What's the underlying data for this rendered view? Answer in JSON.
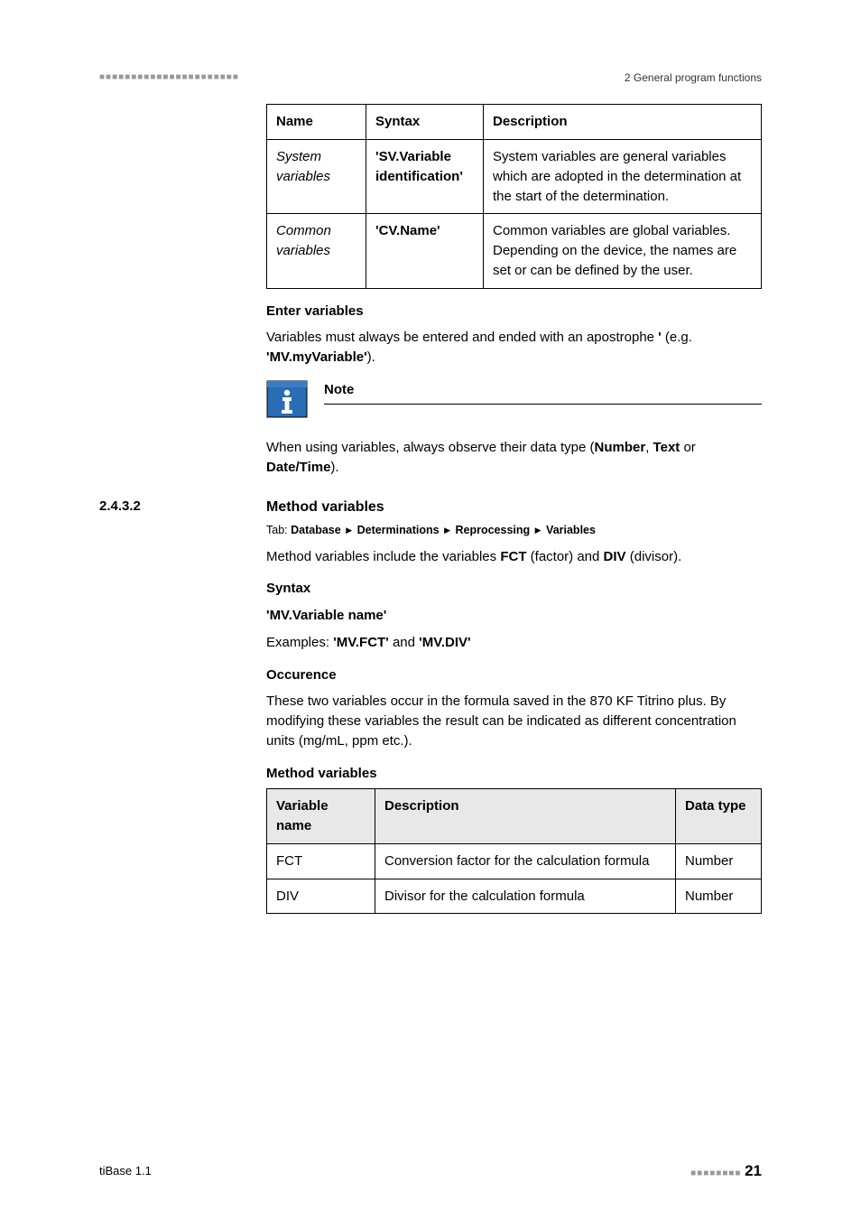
{
  "header": {
    "dots_long": "■■■■■■■■■■■■■■■■■■■■■■",
    "right": "2 General program functions"
  },
  "table1": {
    "headers": {
      "name": "Name",
      "syntax": "Syntax",
      "description": "Description"
    },
    "rows": [
      {
        "name": "System variables",
        "syntax": "'SV.Variable identification'",
        "description": "System variables are general variables which are adopted in the determination at the start of the determination."
      },
      {
        "name": "Common variables",
        "syntax": "'CV.Name'",
        "description": "Common variables are global variables. Depending on the device, the names are set or can be defined by the user."
      }
    ]
  },
  "enter_vars": {
    "heading": "Enter variables",
    "text_before": "Variables must always be entered and ended with an apostrophe ",
    "apos": "'",
    "eg": " (e.g. ",
    "example": "'MV.myVariable'",
    "close": ")."
  },
  "note": {
    "title": "Note",
    "body_before": "When using variables, always observe their data type (",
    "t1": "Number",
    "sep1": ", ",
    "t2": "Text",
    "sep2": " or ",
    "t3": "Date/Time",
    "close": ")."
  },
  "section": {
    "num": "2.4.3.2",
    "title": "Method variables",
    "tab_label": "Tab: ",
    "tab1": "Database",
    "tab2": "Determinations",
    "tab3": "Reprocessing",
    "tab4": "Variables",
    "intro_before": "Method variables include the variables ",
    "fct": "FCT",
    "intro_mid": " (factor) and ",
    "div": "DIV",
    "intro_after": " (divisor).",
    "syntax_heading": "Syntax",
    "syntax_line": "'MV.Variable name'",
    "examples_before": "Examples: ",
    "ex1": "'MV.FCT'",
    "examples_and": " and ",
    "ex2": "'MV.DIV'",
    "occurence_heading": "Occurence",
    "occurence_body": "These two variables occur in the formula saved in the 870 KF Titrino plus. By modifying these variables the result can be indicated as different concentration units (mg/mL, ppm etc.).",
    "mv_heading": "Method variables"
  },
  "table2": {
    "headers": {
      "name": "Variable name",
      "description": "Description",
      "type": "Data type"
    },
    "rows": [
      {
        "name": "FCT",
        "description": "Conversion factor for the calculation formula",
        "type": "Number"
      },
      {
        "name": "DIV",
        "description": "Divisor for the calculation formula",
        "type": "Number"
      }
    ]
  },
  "footer": {
    "left": "tiBase 1.1",
    "dots_short": "■■■■■■■■",
    "page": "21"
  }
}
